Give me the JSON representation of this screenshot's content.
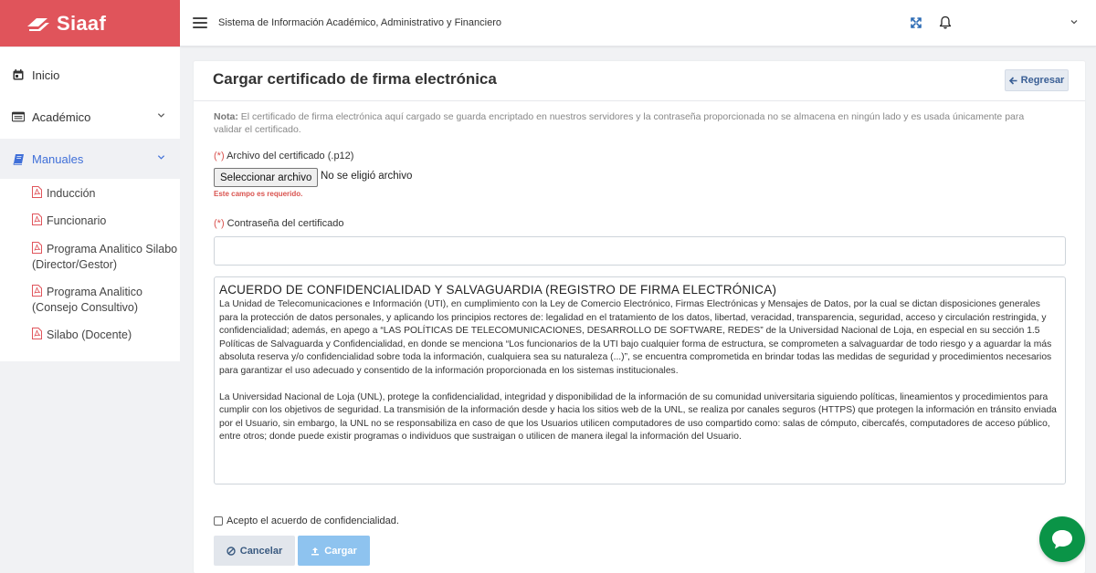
{
  "brand": {
    "name": "Siaaf"
  },
  "header": {
    "app_title": "Sistema de Información Académico, Administrativo y Financiero"
  },
  "sidebar": {
    "items": [
      {
        "label": "Inicio",
        "icon": "calendar-icon"
      },
      {
        "label": "Académico",
        "icon": "id-card-icon"
      },
      {
        "label": "Manuales",
        "icon": "book-icon"
      }
    ],
    "sub_items": [
      "Inducción",
      "Funcionario",
      "Programa Analitico Silabo (Director/Gestor)",
      "Programa Analitico (Consejo Consultivo)",
      "Silabo (Docente)"
    ]
  },
  "main": {
    "title": "Cargar certificado de firma electrónica",
    "back_label": "Regresar",
    "note_label": "Nota:",
    "note_text": " El certificado de firma electrónica aquí cargado se guarda encriptado en nuestros servidores y la contraseña proporcionada no se almacena en ningún lado y es usada únicamente para validar el certificado.",
    "required_mark": "(*)",
    "file_label": "Archivo del certificado (.p12)",
    "file_button": "Seleccionar archivo",
    "file_status": "No se eligió archivo",
    "file_error": "Este campo es requerido.",
    "password_label": "Contraseña del certificado",
    "password_value": "",
    "agreement_title": "ACUERDO DE CONFIDENCIALIDAD Y SALVAGUARDIA (REGISTRO DE FIRMA ELECTRÓNICA)",
    "agreement_p1": "La Unidad de Telecomunicaciones e Información (UTI), en cumplimiento con la Ley de Comercio Electrónico, Firmas Electrónicas y Mensajes de Datos, por la cual se dictan disposiciones generales para la protección de datos personales, y aplicando los principios rectores de: legalidad en el tratamiento de los datos, libertad, veracidad, transparencia, seguridad, acceso y circulación restringida, y confidencialidad; además, en apego a “LAS POLÍTICAS DE TELECOMUNICACIONES, DESARROLLO DE SOFTWARE, REDES” de la Universidad Nacional de Loja, en especial en su sección 1.5 Políticas de Salvaguarda y Confidencialidad, en donde se menciona “Los funcionarios de la UTI bajo cualquier forma de estructura, se comprometen a salvaguardar de todo riesgo y a aguardar la más absoluta reserva y/o confidencialidad sobre toda la información, cualquiera sea su naturaleza (...)”, se encuentra comprometida en brindar todas las medidas de seguridad y procedimientos necesarios para garantizar el uso adecuado y consentido de la información proporcionada en los sistemas institucionales.",
    "agreement_p2": "La Universidad Nacional de Loja (UNL), protege la confidencialidad, integridad y disponibilidad de la información de su comunidad universitaria siguiendo políticas, lineamientos y procedimientos para cumplir con los objetivos de seguridad. La transmisión de la información desde y hacia los sitios web de la UNL, se realiza por canales seguros (HTTPS) que protegen la información en tránsito enviada por el Usuario, sin embargo, la UNL no se responsabiliza en caso de que los Usuarios utilicen computadores de uso compartido como: salas de cómputo, cibercafés, computadores de acceso público, entre otros; donde puede existir programas o individuos que sustraigan o utilicen de manera ilegal la información del Usuario.",
    "accept_label": "Acepto el acuerdo de confidencialidad.",
    "accept_checked": false,
    "cancel_label": "Cancelar",
    "load_label": "Cargar"
  },
  "colors": {
    "brand": "#e0545b",
    "active_nav": "#3f6fd8",
    "required": "#d9534f",
    "primary_button": "#8ec3ef",
    "chat": "#0a9447"
  }
}
